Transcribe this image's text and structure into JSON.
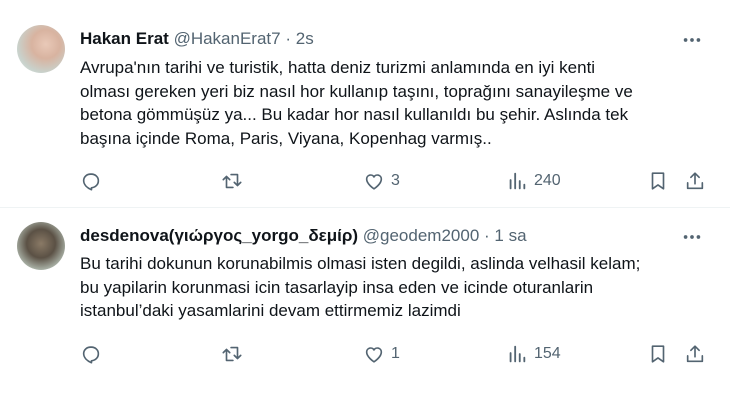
{
  "tweets": [
    {
      "name": "Hakan Erat",
      "handle": "@HakanErat7",
      "dot": "·",
      "time": "2s",
      "text_lines": [
        "Avrupa'nın tarihi ve turistik, hatta deniz turizmi anlamında en iyi kenti",
        "olması gereken yeri biz nasıl hor kullanıp taşını, toprağını sanayileşme ve",
        "betona gömmüşüz ya... Bu kadar hor nasıl kullanıldı bu şehir. Aslında tek",
        "başına içinde Roma, Paris, Viyana, Kopenhag varmış.."
      ],
      "likes": "3",
      "views": "240"
    },
    {
      "name": "desdenova(γιώργος_yorgo_δεμίρ)",
      "handle": "@geodem2000",
      "dot": "·",
      "time": "1 sa",
      "text_lines": [
        "Bu tarihi dokunun korunabilmis olmasi isten degildi, aslinda velhasil kelam;",
        "bu yapilarin korunmasi icin tasarlayip insa eden ve icinde oturanlarin",
        "istanbul’daki yasamlarini devam ettirmemiz lazimdi"
      ],
      "likes": "1",
      "views": "154"
    }
  ],
  "icons": [
    "avatar",
    "more-icon",
    "reply-icon",
    "retweet-icon",
    "like-icon",
    "views-icon",
    "bookmark-icon",
    "share-icon"
  ],
  "colors": {
    "text": "#0f1419",
    "secondary": "#536471",
    "divider": "#eff3f4"
  }
}
